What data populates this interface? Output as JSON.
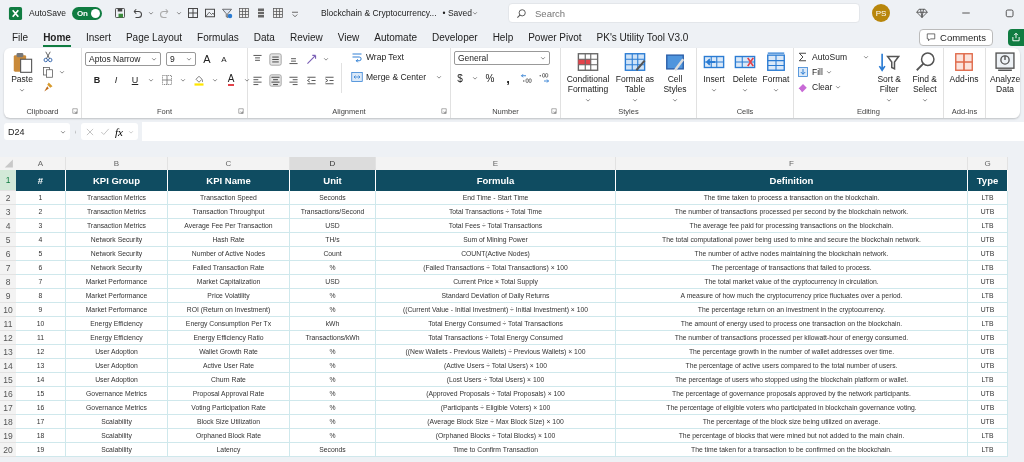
{
  "title_bar": {
    "autosave": {
      "label": "AutoSave",
      "toggle_text": "On",
      "on": true
    },
    "document_title": "Blockchain & Cryptocurrency...",
    "save_status": "• Saved",
    "search": {
      "placeholder": "Search"
    },
    "account": {
      "initials": "PS"
    }
  },
  "menu": {
    "tabs": [
      {
        "label": "File",
        "selected": false
      },
      {
        "label": "Home",
        "selected": true
      },
      {
        "label": "Insert",
        "selected": false
      },
      {
        "label": "Page Layout",
        "selected": false
      },
      {
        "label": "Formulas",
        "selected": false
      },
      {
        "label": "Data",
        "selected": false
      },
      {
        "label": "Review",
        "selected": false
      },
      {
        "label": "View",
        "selected": false
      },
      {
        "label": "Automate",
        "selected": false
      },
      {
        "label": "Developer",
        "selected": false
      },
      {
        "label": "Help",
        "selected": false
      },
      {
        "label": "Power Pivot",
        "selected": false
      },
      {
        "label": "PK's Utility Tool V3.0",
        "selected": false
      }
    ],
    "comments_button": "Comments"
  },
  "ribbon": {
    "groups": [
      {
        "kind": "clipboard",
        "label": "Clipboard",
        "paste": "Paste"
      },
      {
        "kind": "font",
        "label": "Font",
        "font_name": "Aptos Narrow",
        "font_size": "9",
        "grow": "A",
        "shrink": "A",
        "bold": "B",
        "italic": "I",
        "underline": "U",
        "font_color": "A"
      },
      {
        "kind": "alignment",
        "label": "Alignment",
        "wrap_text": "Wrap Text",
        "merge_center": "Merge & Center"
      },
      {
        "kind": "number",
        "label": "Number",
        "format": "General",
        "currency": "$",
        "percent": "%",
        "comma": ","
      },
      {
        "kind": "styles",
        "label": "Styles",
        "buttons": [
          "Conditional Formatting",
          "Format as Table",
          "Cell Styles"
        ]
      },
      {
        "kind": "cells",
        "label": "Cells",
        "buttons": [
          "Insert",
          "Delete",
          "Format"
        ]
      },
      {
        "kind": "editing",
        "label": "Editing",
        "autosum": "AutoSum",
        "fill": "Fill",
        "clear": "Clear",
        "buttons": [
          "Sort & Filter",
          "Find & Select"
        ]
      },
      {
        "kind": "addins",
        "label": "Add-ins",
        "button": "Add-ins"
      },
      {
        "kind": "analyze",
        "button": "Analyze Data"
      }
    ]
  },
  "formula_bar": {
    "name_box": "D24",
    "fx": "fx"
  },
  "sheet": {
    "columns": [
      {
        "letter": "A",
        "selected": false
      },
      {
        "letter": "B",
        "selected": false
      },
      {
        "letter": "C",
        "selected": false
      },
      {
        "letter": "D",
        "selected": true
      },
      {
        "letter": "E",
        "selected": false
      },
      {
        "letter": "F",
        "selected": false
      },
      {
        "letter": "G",
        "selected": false
      }
    ],
    "header_row": {
      "row_number": "1",
      "selected": true,
      "cells": [
        "#",
        "KPI Group",
        "KPI Name",
        "Unit",
        "Formula",
        "Definition",
        "Type"
      ]
    },
    "rows": [
      {
        "row_number": "2",
        "selected": false,
        "cells": [
          "1",
          "Transaction Metrics",
          "Transaction Speed",
          "Seconds",
          "End Time - Start Time",
          "The time taken to process a transaction on the blockchain.",
          "LTB"
        ]
      },
      {
        "row_number": "3",
        "selected": false,
        "cells": [
          "2",
          "Transaction Metrics",
          "Transaction Throughput",
          "Transactions/Second",
          "Total Transactions ÷ Total Time",
          "The number of transactions processed per second by the blockchain network.",
          "UTB"
        ]
      },
      {
        "row_number": "4",
        "selected": false,
        "cells": [
          "3",
          "Transaction Metrics",
          "Average Fee Per Transaction",
          "USD",
          "Total Fees ÷ Total Transactions",
          "The average fee paid for processing transactions on the blockchain.",
          "LTB"
        ]
      },
      {
        "row_number": "5",
        "selected": false,
        "cells": [
          "4",
          "Network Security",
          "Hash Rate",
          "TH/s",
          "Sum of Mining Power",
          "The total computational power being used to mine and secure the blockchain network.",
          "UTB"
        ]
      },
      {
        "row_number": "6",
        "selected": false,
        "cells": [
          "5",
          "Network Security",
          "Number of Active Nodes",
          "Count",
          "COUNT(Active Nodes)",
          "The number of active nodes maintaining the blockchain network.",
          "UTB"
        ]
      },
      {
        "row_number": "7",
        "selected": false,
        "cells": [
          "6",
          "Network Security",
          "Failed Transaction Rate",
          "%",
          "(Failed Transactions ÷ Total Transactions) × 100",
          "The percentage of transactions that failed to process.",
          "LTB"
        ]
      },
      {
        "row_number": "8",
        "selected": false,
        "cells": [
          "7",
          "Market Performance",
          "Market Capitalization",
          "USD",
          "Current Price × Total Supply",
          "The total market value of the cryptocurrency in circulation.",
          "UTB"
        ]
      },
      {
        "row_number": "9",
        "selected": false,
        "cells": [
          "8",
          "Market Performance",
          "Price Volatility",
          "%",
          "Standard Deviation of Daily Returns",
          "A measure of how much the cryptocurrency price fluctuates over a period.",
          "LTB"
        ]
      },
      {
        "row_number": "10",
        "selected": false,
        "cells": [
          "9",
          "Market Performance",
          "ROI (Return on Investment)",
          "%",
          "((Current Value - Initial Investment) ÷ Initial Investment) × 100",
          "The percentage return on an investment in the cryptocurrency.",
          "UTB"
        ]
      },
      {
        "row_number": "11",
        "selected": false,
        "cells": [
          "10",
          "Energy Efficiency",
          "Energy Consumption Per Tx",
          "kWh",
          "Total Energy Consumed ÷ Total Transactions",
          "The amount of energy used to process one transaction on the blockchain.",
          "LTB"
        ]
      },
      {
        "row_number": "12",
        "selected": false,
        "cells": [
          "11",
          "Energy Efficiency",
          "Energy Efficiency Ratio",
          "Transactions/kWh",
          "Total Transactions ÷ Total Energy Consumed",
          "The number of transactions processed per kilowatt-hour of energy consumed.",
          "UTB"
        ]
      },
      {
        "row_number": "13",
        "selected": false,
        "cells": [
          "12",
          "User Adoption",
          "Wallet Growth Rate",
          "%",
          "((New Wallets - Previous Wallets) ÷ Previous Wallets) × 100",
          "The percentage growth in the number of wallet addresses over time.",
          "UTB"
        ]
      },
      {
        "row_number": "14",
        "selected": false,
        "cells": [
          "13",
          "User Adoption",
          "Active User Rate",
          "%",
          "(Active Users ÷ Total Users) × 100",
          "The percentage of active users compared to the total number of users.",
          "UTB"
        ]
      },
      {
        "row_number": "15",
        "selected": false,
        "cells": [
          "14",
          "User Adoption",
          "Churn Rate",
          "%",
          "(Lost Users ÷ Total Users) × 100",
          "The percentage of users who stopped using the blockchain platform or wallet.",
          "LTB"
        ]
      },
      {
        "row_number": "16",
        "selected": false,
        "cells": [
          "15",
          "Governance Metrics",
          "Proposal Approval Rate",
          "%",
          "(Approved Proposals ÷ Total Proposals) × 100",
          "The percentage of governance proposals approved by the network participants.",
          "UTB"
        ]
      },
      {
        "row_number": "17",
        "selected": false,
        "cells": [
          "16",
          "Governance Metrics",
          "Voting Participation Rate",
          "%",
          "(Participants ÷ Eligible Voters) × 100",
          "The percentage of eligible voters who participated in blockchain governance voting.",
          "UTB"
        ]
      },
      {
        "row_number": "18",
        "selected": false,
        "cells": [
          "17",
          "Scalability",
          "Block Size Utilization",
          "%",
          "(Average Block Size ÷ Max Block Size) × 100",
          "The percentage of the block size being utilized on average.",
          "UTB"
        ]
      },
      {
        "row_number": "19",
        "selected": false,
        "cells": [
          "18",
          "Scalability",
          "Orphaned Block Rate",
          "%",
          "(Orphaned Blocks ÷ Total Blocks) × 100",
          "The percentage of blocks that were mined but not added to the main chain.",
          "LTB"
        ]
      },
      {
        "row_number": "20",
        "selected": false,
        "cells": [
          "19",
          "Scalability",
          "Latency",
          "Seconds",
          "Time to Confirm Transaction",
          "The time taken for a transaction to be confirmed on the blockchain.",
          "LTB"
        ]
      }
    ]
  }
}
